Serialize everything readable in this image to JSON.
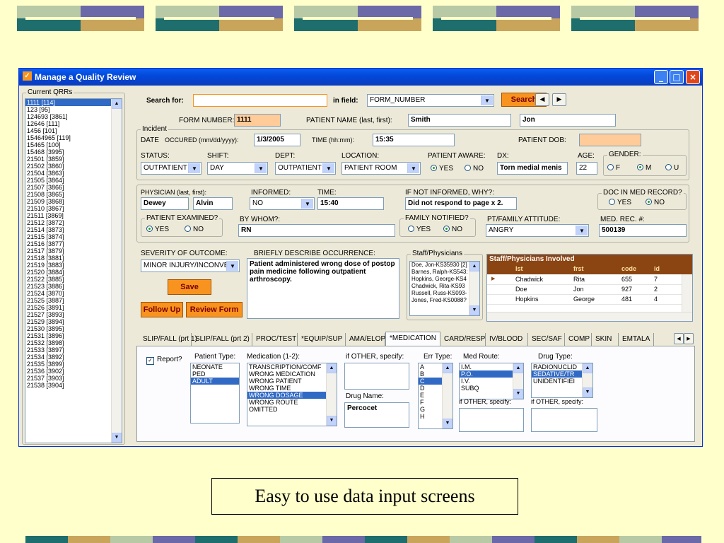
{
  "window": {
    "title": "Manage a Quality Review"
  },
  "qrr": {
    "group_label": "Current QRRs",
    "items": [
      "1111 [114]",
      "123 [95]",
      "124693 [3861]",
      "12646 [111]",
      "1456 [101]",
      "15464965 [119]",
      "15465 [100]",
      "15468 [3995]",
      "21501 [3859]",
      "21502 [3860]",
      "21504 [3863]",
      "21505 [3864]",
      "21507 [3866]",
      "21508 [3865]",
      "21509 [3868]",
      "21510 [3867]",
      "21511 [3869]",
      "21512 [3872]",
      "21514 [3873]",
      "21515 [3874]",
      "21516 [3877]",
      "21517 [3879]",
      "21518 [3881]",
      "21519 [3883]",
      "21520 [3884]",
      "21522 [3885]",
      "21523 [3886]",
      "21524 [3870]",
      "21525 [3887]",
      "21526 [3891]",
      "21527 [3893]",
      "21529 [3894]",
      "21530 [3895]",
      "21531 [3896]",
      "21532 [3898]",
      "21533 [3897]",
      "21534 [3892]",
      "21535 [3899]",
      "21536 [3902]",
      "21537 [3903]",
      "21538 [3904]"
    ]
  },
  "search": {
    "label": "Search for:",
    "value": "",
    "field_label": "in field:",
    "field_value": "FORM_NUMBER",
    "button": "Search"
  },
  "form": {
    "form_number_label": "FORM NUMBER:",
    "form_number": "1111",
    "patient_name_label": "PATIENT NAME (last, first):",
    "last_name": "Smith",
    "first_name": "Jon",
    "incident_label": "Incident",
    "date_label": "DATE",
    "occured_label": "OCCURED (mm/dd/yyyy):",
    "date": "1/3/2005",
    "time_label": "TIME (hh:mm):",
    "time": "15:35",
    "dob_label": "PATIENT DOB:",
    "dob": "",
    "status_label": "STATUS:",
    "status": "OUTPATIENT",
    "shift_label": "SHIFT:",
    "shift": "DAY",
    "dept_label": "DEPT:",
    "dept": "OUTPATIENT",
    "location_label": "LOCATION:",
    "location": "PATIENT ROOM",
    "aware_label": "PATIENT AWARE:",
    "aware_yes": "YES",
    "aware_no": "NO",
    "dx_label": "DX:",
    "dx": "Torn medial menis",
    "age_label": "AGE:",
    "age": "22",
    "gender_label": "GENDER:",
    "gender_f": "F",
    "gender_m": "M",
    "gender_u": "U",
    "physician_label": "PHYSICIAN (last, first):",
    "physician_last": "Dewey",
    "physician_first": "Alvin",
    "informed_label": "INFORMED:",
    "informed": "NO",
    "time2_label": "TIME:",
    "time2": "15:40",
    "why_label": "IF NOT INFORMED, WHY?:",
    "why": "Did not respond to page x 2.",
    "doc_label": "DOC IN MED RECORD?",
    "doc_yes": "YES",
    "doc_no": "NO",
    "examined_label": "PATIENT EXAMINED?",
    "ex_yes": "YES",
    "ex_no": "NO",
    "bywhom_label": "BY WHOM?:",
    "bywhom": "RN",
    "family_label": "FAMILY NOTIFIED?",
    "fam_yes": "YES",
    "fam_no": "NO",
    "attitude_label": "PT/FAMILY ATTITUDE:",
    "attitude": "ANGRY",
    "medrec_label": "MED. REC. #:",
    "medrec": "500139",
    "severity_label": "SEVERITY OF OUTCOME:",
    "severity": "MINOR INJURY/INCONVE",
    "describe_label": "BRIEFLY DESCRIBE OCCURRENCE:",
    "describe": "Patient administered wrong dose of postop pain medicine following outpatient arthroscopy.",
    "save": "Save",
    "followup": "Follow Up",
    "review": "Review Form"
  },
  "staff": {
    "label": "Staff/Physicians",
    "list": [
      "Doe, Jon-KS35930 [2]",
      "Barnes, Ralph-KS543:",
      "Hopkins, George-KS4",
      "Chadwick, Rita-KS93",
      "Russell, Russ-KS093-",
      "Jones, Fred-KS0088?"
    ],
    "grid_title": "Staff/Physicians Involved",
    "columns": [
      "lst",
      "frst",
      "code",
      "id"
    ],
    "rows": [
      [
        "Chadwick",
        "Rita",
        "655",
        "7"
      ],
      [
        "Doe",
        "Jon",
        "927",
        "2"
      ],
      [
        "Hopkins",
        "George",
        "481",
        "4"
      ]
    ]
  },
  "tabs": [
    "SLIP/FALL (prt 1)",
    "SLIP/FALL (prt 2)",
    "PROC/TEST",
    "*EQUIP/SUP",
    "AMA/ELOP",
    "*MEDICATION",
    "CARD/RESP",
    "IV/BLOOD",
    "SEC/SAF",
    "COMP",
    "SKIN",
    "EMTALA"
  ],
  "medication": {
    "report_label": "Report?",
    "patient_type_label": "Patient Type:",
    "patient_types": [
      "NEONATE",
      "PED",
      "ADULT"
    ],
    "med_label": "Medication (1-2):",
    "meds": [
      "TRANSCRIPTION/COMF",
      "WRONG MEDICATION",
      "WRONG PATIENT",
      "WRONG TIME",
      "WRONG DOSAGE",
      "WRONG ROUTE",
      "OMITTED"
    ],
    "other_label": "if OTHER, specify:",
    "drug_name_label": "Drug Name:",
    "drug_name": "Percocet",
    "err_label": "Err Type:",
    "errs": [
      "A",
      "B",
      "C",
      "D",
      "E",
      "F",
      "G",
      "H"
    ],
    "route_label": "Med Route:",
    "routes": [
      "I.M.",
      "P.O.",
      "I.V.",
      "SUBQ"
    ],
    "route_other_label": "if OTHER, specify:",
    "drug_type_label": "Drug Type:",
    "drug_types": [
      "RADIONUCLID",
      "SEDATIVE/TR",
      "UNIDENTIFIEI"
    ],
    "drug_other_label": "if OTHER, specify:"
  },
  "caption": "Easy to use data input screens",
  "colors": {
    "band_purple": "#6B69A8",
    "band_gold": "#C9A55C",
    "band_teal": "#1E6E6E",
    "band_pale": "#B8C9A6",
    "accent_orange": "#F7931E",
    "grid_header": "#8B4513"
  }
}
